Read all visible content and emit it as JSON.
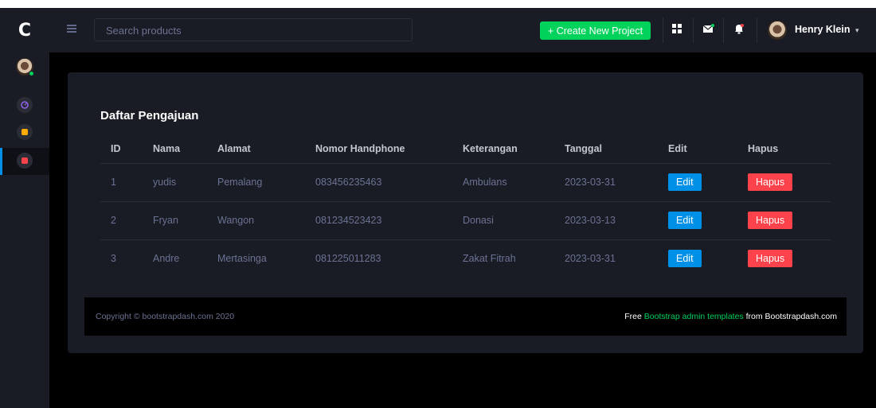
{
  "brand": {
    "letter": "C"
  },
  "navbar": {
    "search_placeholder": "Search products",
    "create_label": "+ Create New Project",
    "user_name": "Henry Klein"
  },
  "card": {
    "title": "Daftar Pengajuan",
    "columns": [
      "ID",
      "Nama",
      "Alamat",
      "Nomor Handphone",
      "Keterangan",
      "Tanggal",
      "Edit",
      "Hapus"
    ],
    "rows": [
      {
        "id": "1",
        "nama": "yudis",
        "alamat": "Pemalang",
        "hp": "083456235463",
        "keterangan": "Ambulans",
        "tanggal": "2023-03-31",
        "edit": "Edit",
        "hapus": "Hapus"
      },
      {
        "id": "2",
        "nama": "Fryan",
        "alamat": "Wangon",
        "hp": "081234523423",
        "keterangan": "Donasi",
        "tanggal": "2023-03-13",
        "edit": "Edit",
        "hapus": "Hapus"
      },
      {
        "id": "3",
        "nama": "Andre",
        "alamat": "Mertasinga",
        "hp": "081225011283",
        "keterangan": "Zakat Fitrah",
        "tanggal": "2023-03-31",
        "edit": "Edit",
        "hapus": "Hapus"
      }
    ]
  },
  "footer": {
    "copyright": "Copyright © bootstrapdash.com 2020",
    "free_prefix": "Free ",
    "free_link": "Bootstrap admin templates",
    "free_suffix": " from Bootstrapdash.com"
  },
  "colors": {
    "bg": "#000000",
    "panel": "#191c24",
    "accent_green": "#00d25b",
    "accent_blue": "#0090e7",
    "accent_red": "#fc424a",
    "muted_text": "#6c7293"
  },
  "icons": {
    "sidebar": [
      "dashboard-icon",
      "form-icon",
      "table-icon"
    ],
    "navbar": [
      "menu-icon",
      "apps-grid-icon",
      "mail-icon",
      "bell-icon",
      "chevron-down-icon"
    ]
  }
}
